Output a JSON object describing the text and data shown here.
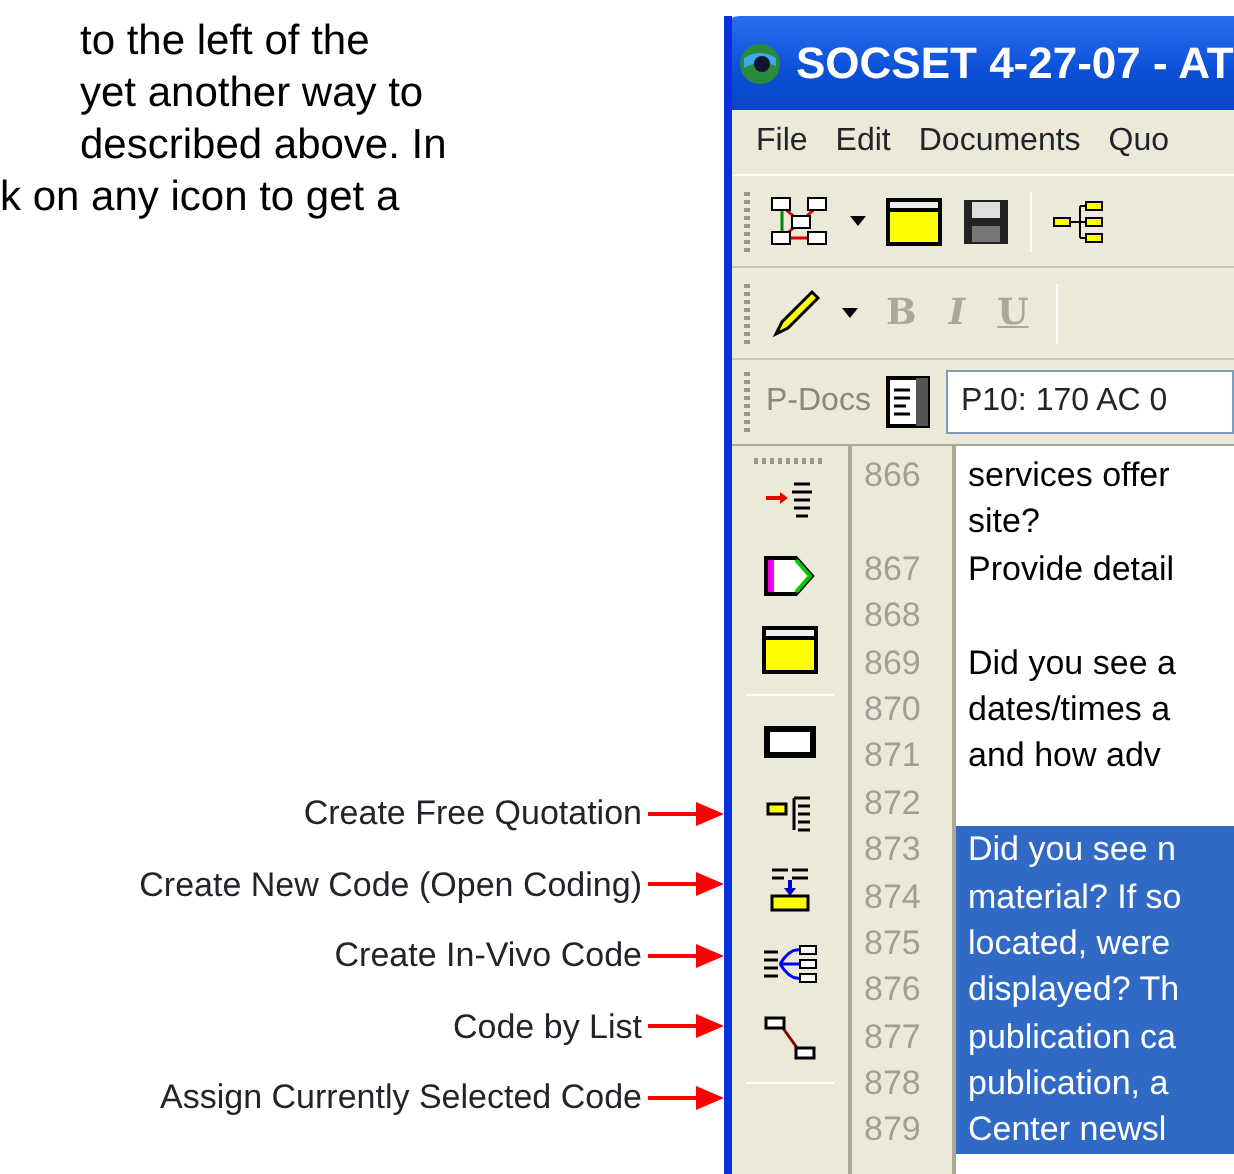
{
  "paragraph_lines": [
    "to the left of the",
    "yet another way to",
    "described above.  In",
    "k on any icon to get a"
  ],
  "callouts": [
    "Create Free Quotation",
    "Create New Code (Open Coding)",
    "Create In-Vivo Code",
    "Code by List",
    "Assign Currently Selected Code"
  ],
  "window": {
    "title": "SOCSET 4-27-07 - AT",
    "menu": [
      "File",
      "Edit",
      "Documents",
      "Quo"
    ],
    "format_buttons": [
      {
        "label": "B",
        "disabled": true
      },
      {
        "label": "I",
        "disabled": true
      },
      {
        "label": "U",
        "disabled": true
      }
    ],
    "pdocs": {
      "label": "P-Docs",
      "value": "P10: 170 AC 0"
    },
    "lines": [
      {
        "number": "866",
        "text": "services offer",
        "selected": false
      },
      {
        "text": "site?",
        "selected": false
      },
      {
        "number": "867",
        "text": "Provide detail",
        "selected": false
      },
      {
        "number": "868",
        "selected": false
      },
      {
        "number": "869",
        "text": "Did you see a",
        "selected": false
      },
      {
        "number": "870",
        "text": "dates/times a",
        "selected": false
      },
      {
        "number": "871",
        "text": "and how adv",
        "selected": false
      },
      {
        "number": "872",
        "selected": false
      },
      {
        "number": "873",
        "text": "Did you see n",
        "selected": true
      },
      {
        "number": "874",
        "text": "material? If so",
        "selected": true
      },
      {
        "number": "875",
        "text": "located, were",
        "selected": true
      },
      {
        "number": "876",
        "text": "displayed? Th",
        "selected": true
      },
      {
        "number": "877",
        "text": "publication ca",
        "selected": true
      },
      {
        "number": "878",
        "text": "publication, a",
        "selected": true
      },
      {
        "number": "879",
        "text": "Center newsl",
        "selected": true
      }
    ]
  }
}
